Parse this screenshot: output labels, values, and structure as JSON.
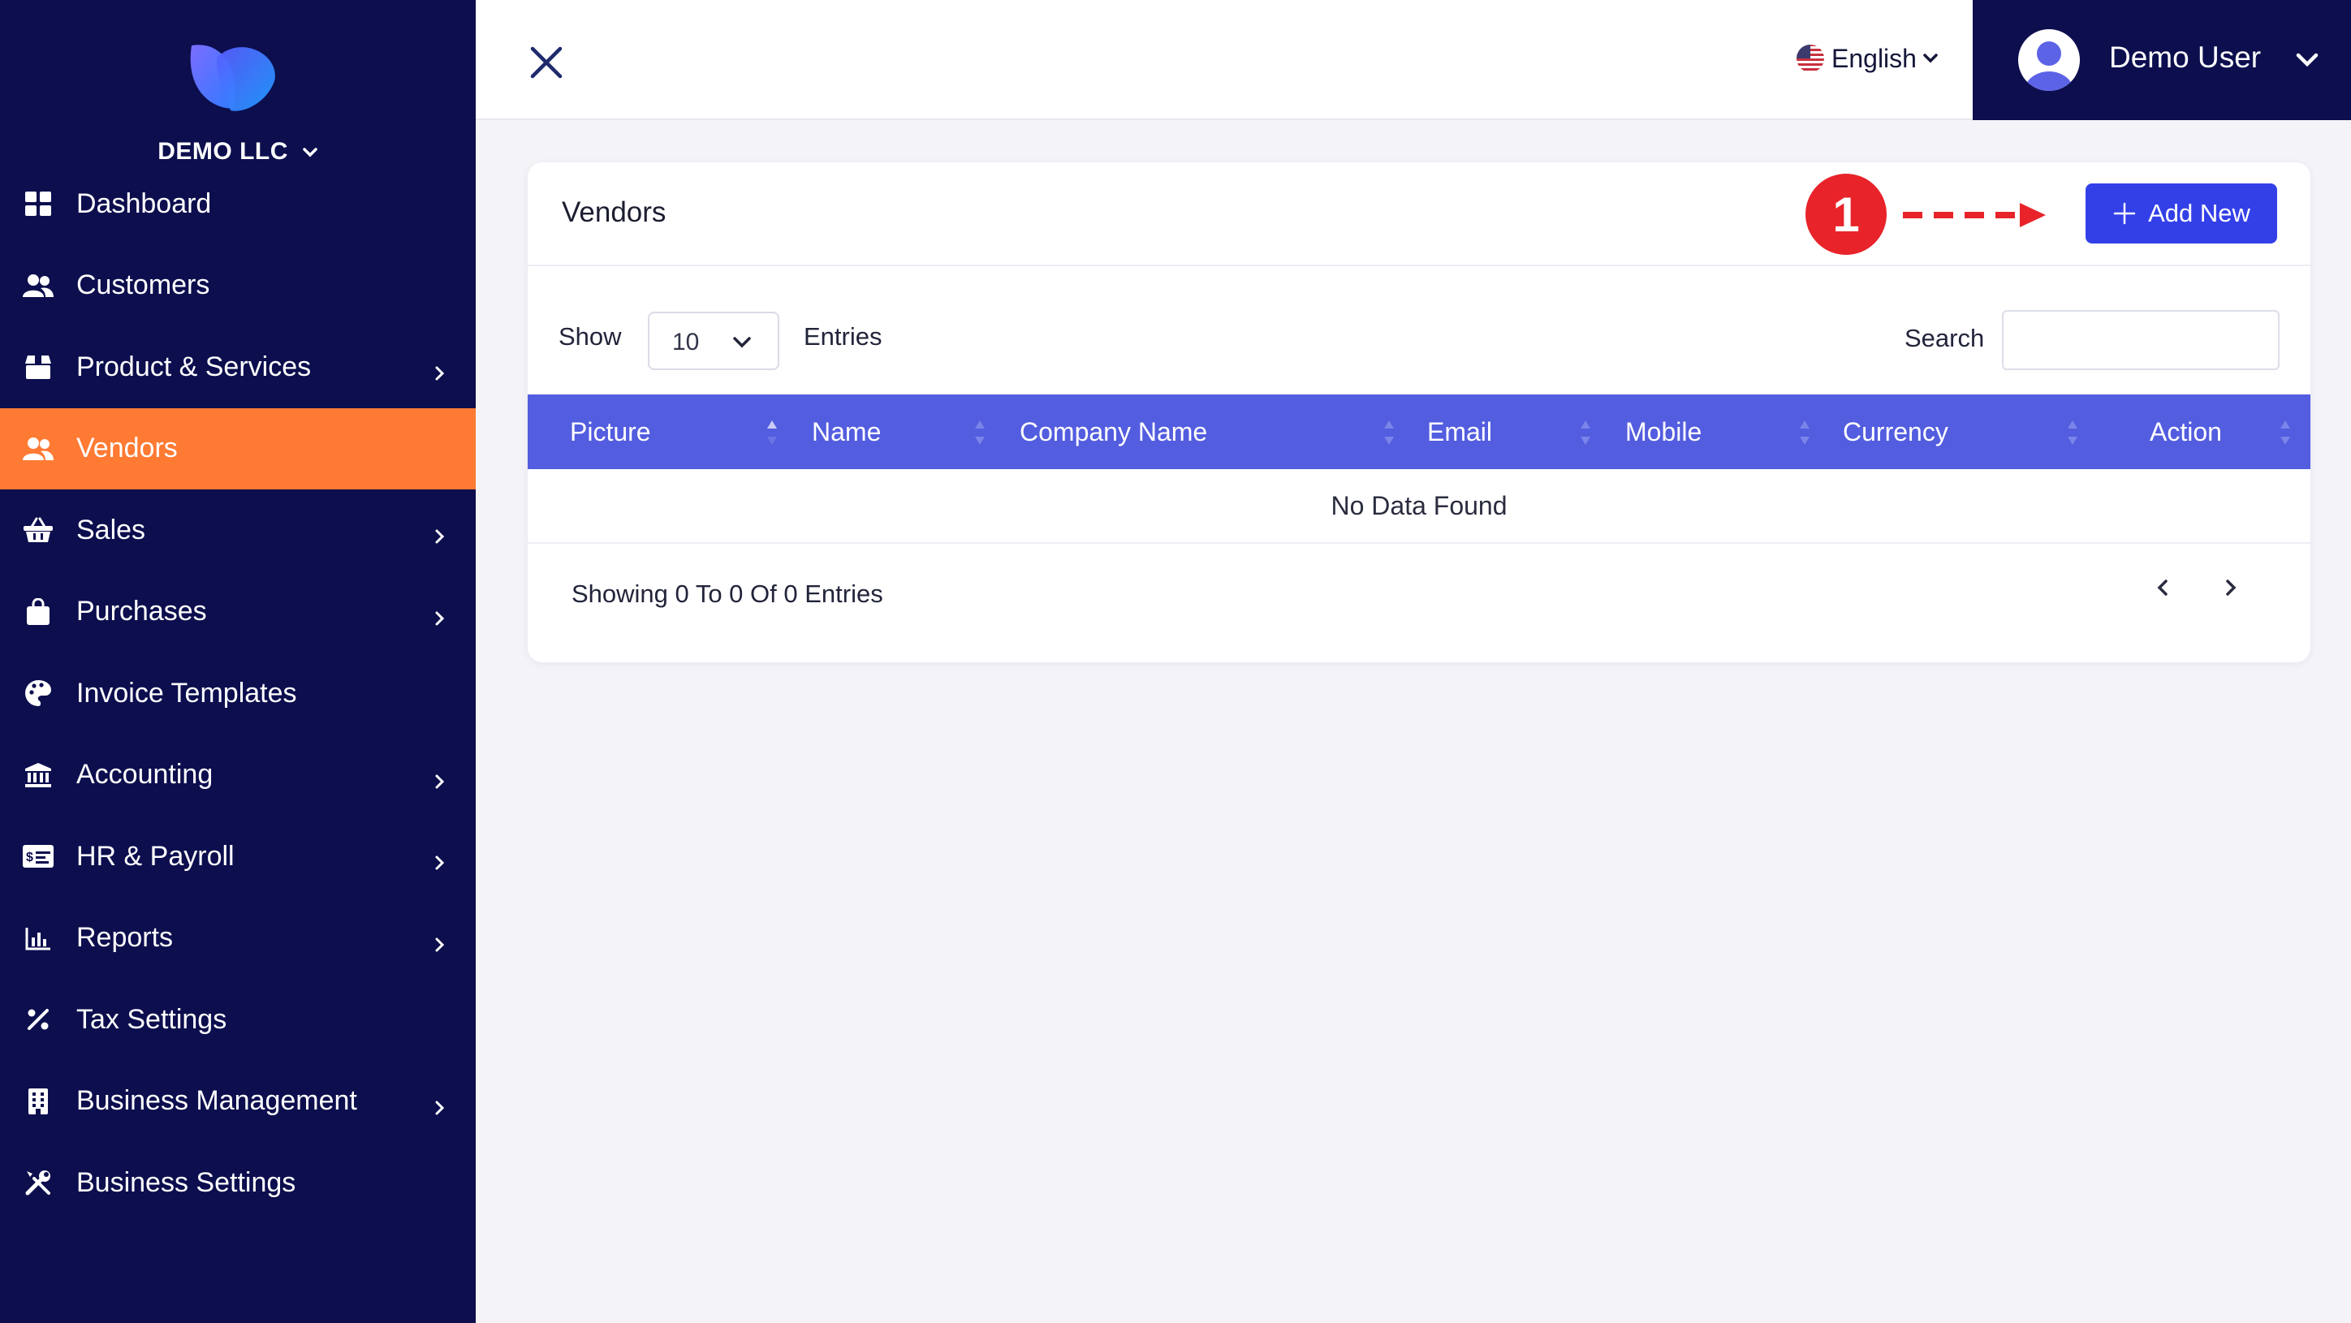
{
  "sidebar": {
    "company": "DEMO LLC",
    "items": [
      {
        "label": "Dashboard",
        "icon": "dashboard-icon",
        "active": false,
        "has_submenu": false
      },
      {
        "label": "Customers",
        "icon": "users-icon",
        "active": false,
        "has_submenu": false
      },
      {
        "label": "Product & Services",
        "icon": "box-icon",
        "active": false,
        "has_submenu": true
      },
      {
        "label": "Vendors",
        "icon": "users-icon",
        "active": true,
        "has_submenu": false
      },
      {
        "label": "Sales",
        "icon": "basket-icon",
        "active": false,
        "has_submenu": true
      },
      {
        "label": "Purchases",
        "icon": "bag-icon",
        "active": false,
        "has_submenu": true
      },
      {
        "label": "Invoice Templates",
        "icon": "palette-icon",
        "active": false,
        "has_submenu": false
      },
      {
        "label": "Accounting",
        "icon": "bank-icon",
        "active": false,
        "has_submenu": true
      },
      {
        "label": "HR & Payroll",
        "icon": "id-card-icon",
        "active": false,
        "has_submenu": true
      },
      {
        "label": "Reports",
        "icon": "bar-chart-icon",
        "active": false,
        "has_submenu": true
      },
      {
        "label": "Tax Settings",
        "icon": "percent-icon",
        "active": false,
        "has_submenu": false
      },
      {
        "label": "Business Management",
        "icon": "building-icon",
        "active": false,
        "has_submenu": true
      },
      {
        "label": "Business Settings",
        "icon": "tools-icon",
        "active": false,
        "has_submenu": false
      }
    ]
  },
  "topbar": {
    "language": "English",
    "user_name": "Demo User"
  },
  "card": {
    "title": "Vendors",
    "annotation_number": "1",
    "add_button_label": "Add New",
    "show_label": "Show",
    "entries_value": "10",
    "entries_label": "Entries",
    "search_label": "Search",
    "search_value": ""
  },
  "table": {
    "columns": [
      "Picture",
      "Name",
      "Company Name",
      "Email",
      "Mobile",
      "Currency",
      "Action"
    ],
    "empty_message": "No Data Found",
    "showing_text": "Showing 0 To 0 Of 0 Entries"
  },
  "colors": {
    "sidebar_bg": "#0c0e4e",
    "active_item": "#ff7a33",
    "table_header": "#535ddf",
    "primary_button": "#3340e8",
    "annotation": "#e8232a"
  }
}
